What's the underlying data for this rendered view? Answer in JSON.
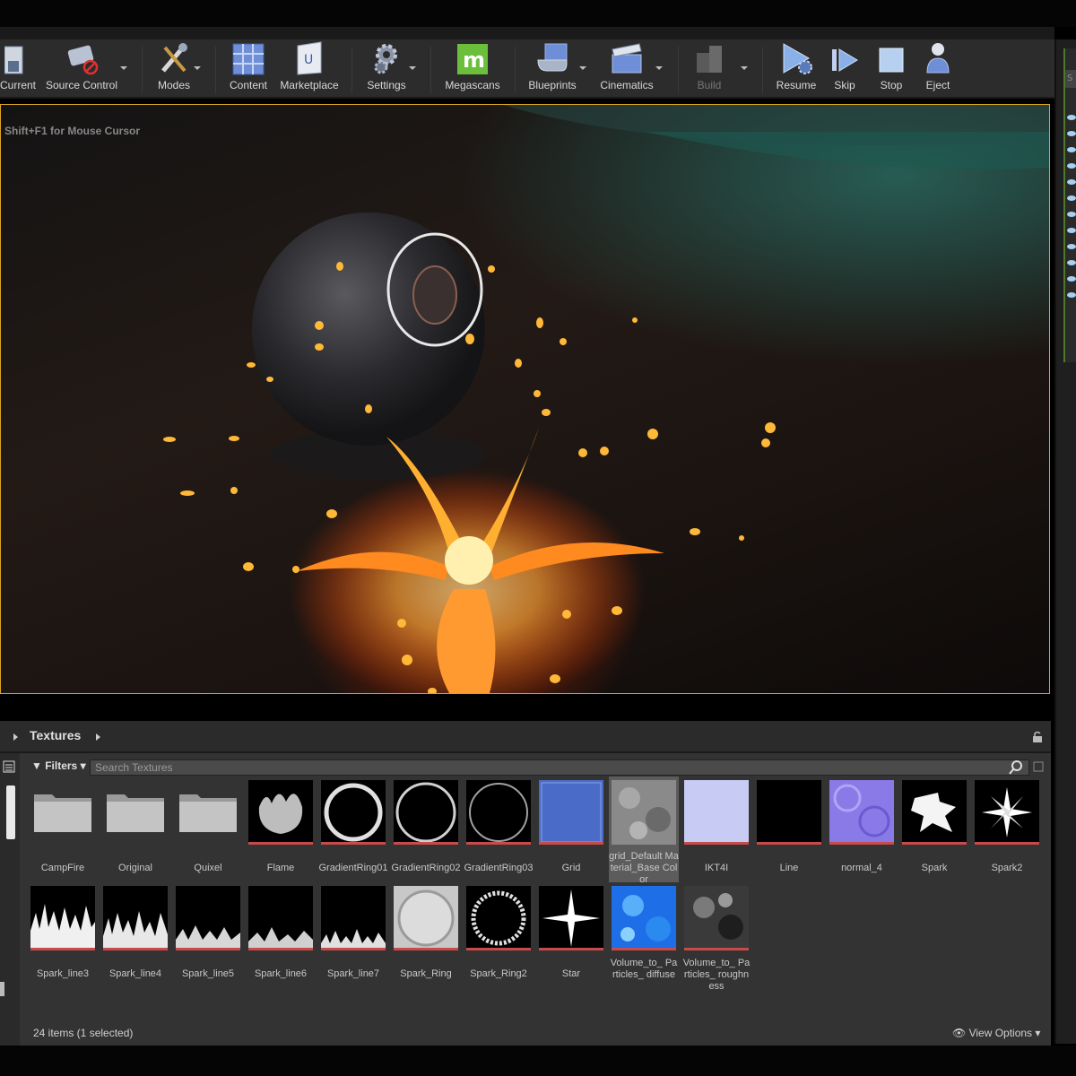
{
  "toolbar": {
    "buttons": [
      {
        "label": "Current",
        "icon": "save-icon"
      },
      {
        "label": "Source Control",
        "icon": "source-control-icon"
      },
      {
        "label": "Modes",
        "icon": "modes-icon"
      },
      {
        "label": "Content",
        "icon": "content-icon"
      },
      {
        "label": "Marketplace",
        "icon": "marketplace-icon"
      },
      {
        "label": "Settings",
        "icon": "settings-icon"
      },
      {
        "label": "Megascans",
        "icon": "megascans-icon"
      },
      {
        "label": "Blueprints",
        "icon": "blueprints-icon"
      },
      {
        "label": "Cinematics",
        "icon": "cinematics-icon"
      },
      {
        "label": "Build",
        "icon": "build-icon"
      },
      {
        "label": "Resume",
        "icon": "resume-icon"
      },
      {
        "label": "Skip",
        "icon": "skip-icon"
      },
      {
        "label": "Stop",
        "icon": "stop-icon"
      },
      {
        "label": "Eject",
        "icon": "eject-icon"
      }
    ]
  },
  "viewport": {
    "hint": "Shift+F1 for Mouse Cursor"
  },
  "content_browser": {
    "path": "Textures",
    "filters_label": "Filters",
    "search_placeholder": "Search Textures",
    "status": "24 items (1 selected)",
    "view_options": "View Options",
    "assets_row1": [
      {
        "name": "CampFire",
        "type": "folder"
      },
      {
        "name": "Original",
        "type": "folder"
      },
      {
        "name": "Quixel",
        "type": "folder"
      },
      {
        "name": "Flame",
        "type": "texture"
      },
      {
        "name": "GradientRing01",
        "type": "texture"
      },
      {
        "name": "GradientRing02",
        "type": "texture"
      },
      {
        "name": "GradientRing03",
        "type": "texture"
      },
      {
        "name": "Grid",
        "type": "texture"
      },
      {
        "name": "grid_Default Material_Base Color",
        "type": "texture",
        "selected": true
      },
      {
        "name": "IKT4I",
        "type": "texture"
      },
      {
        "name": "Line",
        "type": "texture"
      },
      {
        "name": "normal_4",
        "type": "texture"
      },
      {
        "name": "Spark",
        "type": "texture"
      },
      {
        "name": "Spark2",
        "type": "texture"
      }
    ],
    "assets_row2": [
      {
        "name": "Spark_line3",
        "type": "texture"
      },
      {
        "name": "Spark_line4",
        "type": "texture"
      },
      {
        "name": "Spark_line5",
        "type": "texture"
      },
      {
        "name": "Spark_line6",
        "type": "texture"
      },
      {
        "name": "Spark_line7",
        "type": "texture"
      },
      {
        "name": "Spark_Ring",
        "type": "texture"
      },
      {
        "name": "Spark_Ring2",
        "type": "texture"
      },
      {
        "name": "Star",
        "type": "texture"
      },
      {
        "name": "Volume_to_ Particles_ diffuse",
        "type": "texture"
      },
      {
        "name": "Volume_to_ Particles_ roughness",
        "type": "texture"
      }
    ]
  },
  "colors": {
    "viewport_border": "#d9a521",
    "texture_underline": "#c84b4b",
    "outliner_accent": "#4a7a2a"
  }
}
